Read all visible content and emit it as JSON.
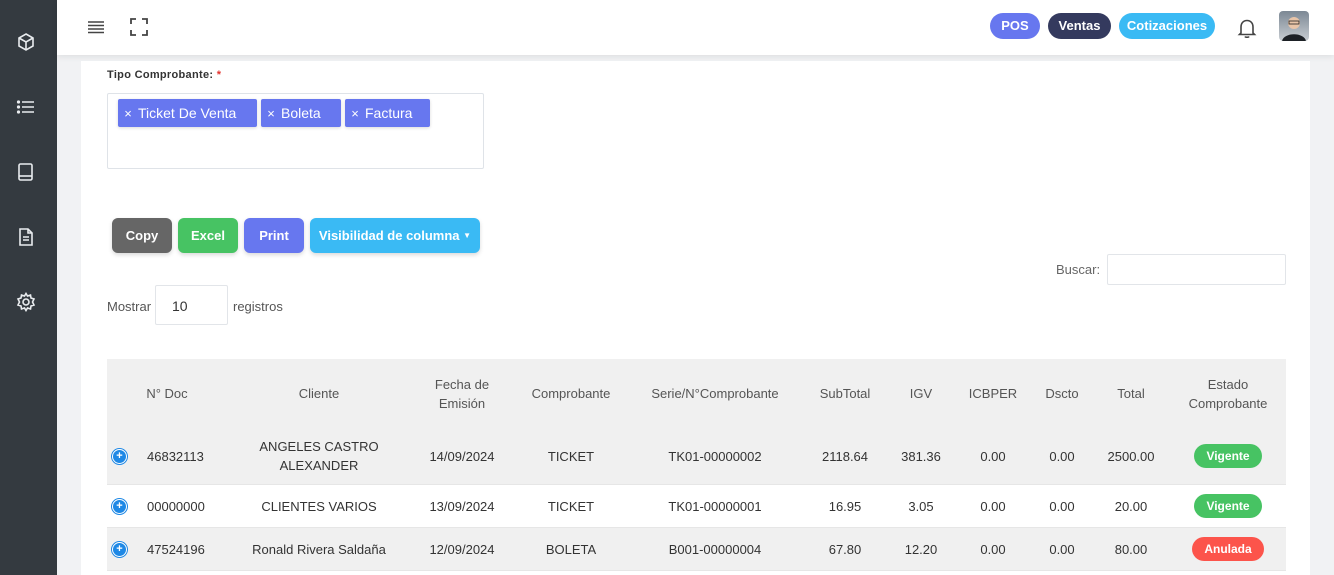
{
  "sidebar": {
    "icons": [
      "box-icon",
      "list-icon",
      "book-icon",
      "document-icon",
      "gear-icon"
    ]
  },
  "topbar": {
    "pos_label": "POS",
    "ventas_label": "Ventas",
    "cotizaciones_label": "Cotizaciones",
    "colors": {
      "pos": "#6777ef",
      "ventas": "#343a5e",
      "cotizaciones": "#3abaf4"
    }
  },
  "filter": {
    "label": "Tipo Comprobante:",
    "required_mark": "*",
    "chips": [
      "Ticket De Venta",
      "Boleta",
      "Factura"
    ],
    "chip_remove": "×"
  },
  "buttons": {
    "copy": "Copy",
    "excel": "Excel",
    "print": "Print",
    "visibility": "Visibilidad de columna"
  },
  "search": {
    "label": "Buscar:",
    "value": ""
  },
  "length": {
    "prefix": "Mostrar",
    "value": "10",
    "suffix": "registros"
  },
  "table": {
    "headers": [
      "N° Doc",
      "Cliente",
      "Fecha de Emisión",
      "Comprobante",
      "Serie/N°Comprobante",
      "SubTotal",
      "IGV",
      "ICBPER",
      "Dscto",
      "Total",
      "Estado Comprobante"
    ],
    "rows": [
      {
        "doc": "46832113",
        "cliente": "ANGELES CASTRO ALEXANDER",
        "fecha": "14/09/2024",
        "comprobante": "TICKET",
        "serie": "TK01-00000002",
        "subtotal": "2118.64",
        "igv": "381.36",
        "icbper": "0.00",
        "dscto": "0.00",
        "total": "2500.00",
        "estado": "Vigente"
      },
      {
        "doc": "00000000",
        "cliente": "CLIENTES VARIOS",
        "fecha": "13/09/2024",
        "comprobante": "TICKET",
        "serie": "TK01-00000001",
        "subtotal": "16.95",
        "igv": "3.05",
        "icbper": "0.00",
        "dscto": "0.00",
        "total": "20.00",
        "estado": "Vigente"
      },
      {
        "doc": "47524196",
        "cliente": "Ronald Rivera Saldaña",
        "fecha": "12/09/2024",
        "comprobante": "BOLETA",
        "serie": "B001-00000004",
        "subtotal": "67.80",
        "igv": "12.20",
        "icbper": "0.00",
        "dscto": "0.00",
        "total": "80.00",
        "estado": "Anulada"
      }
    ],
    "status_colors": {
      "Vigente": "#47c363",
      "Anulada": "#fc544b"
    }
  }
}
